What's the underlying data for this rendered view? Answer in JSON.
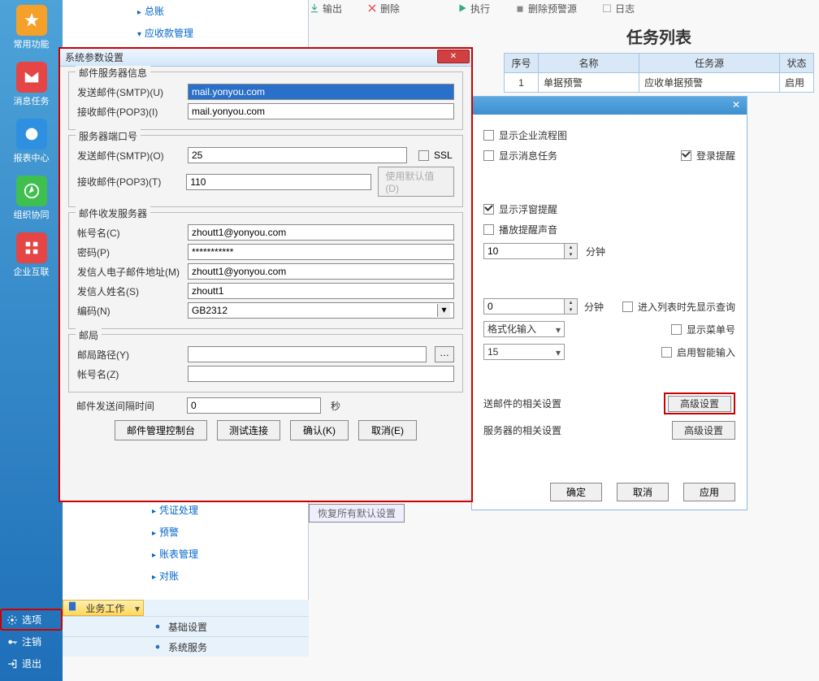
{
  "sidebar": {
    "items": [
      {
        "label": "常用功能",
        "color": "#f5a028"
      },
      {
        "label": "消息任务",
        "color": "#e64545"
      },
      {
        "label": "报表中心",
        "color": "#2f8fe0"
      },
      {
        "label": "组织协同",
        "color": "#3fbf4f"
      },
      {
        "label": "企业互联",
        "color": "#e64545"
      }
    ],
    "bottom": {
      "options": "选项",
      "logout": "注销",
      "exit": "退出"
    }
  },
  "tree": {
    "items": [
      {
        "label": "总账",
        "lv": 1,
        "arrow": "▶"
      },
      {
        "label": "应收款管理",
        "lv": 1,
        "arrow": "▼"
      },
      {
        "label": "凭证处理",
        "lv": 2,
        "arrow": "▶"
      },
      {
        "label": "预警",
        "lv": 2,
        "arrow": "▶"
      },
      {
        "label": "账表管理",
        "lv": 2,
        "arrow": "▶"
      },
      {
        "label": "对账",
        "lv": 2,
        "arrow": "▶"
      }
    ]
  },
  "cats": {
    "biz": "业务工作",
    "base": "基础设置",
    "sys": "系统服务"
  },
  "toolbar": {
    "output": "输出",
    "delete": "删除",
    "exec": "执行",
    "delalert": "删除预警源",
    "log": "日志"
  },
  "tasklist": {
    "title": "任务列表",
    "cols": {
      "no": "序号",
      "name": "名称",
      "src": "任务源",
      "stat": "状态"
    },
    "row": {
      "no": "1",
      "name": "单据预警",
      "src": "应收单据预警",
      "stat": "启用"
    }
  },
  "under": {
    "show_flow": "显示企业流程图",
    "show_msg": "显示消息任务",
    "login_remind": "登录提醒",
    "show_float": "显示浮窗提醒",
    "play_sound": "播放提醒声音",
    "interval": "10",
    "interval_unit": "分钟",
    "v2": "0",
    "v2_unit": "分钟",
    "enter_query": "进入列表时先显示查询",
    "fmt_input": "格式化输入",
    "show_menu": "显示菜单号",
    "v3": "15",
    "enable_smart": "启用智能输入",
    "mail_related": "送邮件的相关设置",
    "server_related": "服务器的相关设置",
    "adv": "高级设置",
    "ok": "确定",
    "cancel": "取消",
    "apply": "应用"
  },
  "restore": "恢复所有默认设置",
  "modal": {
    "title": "系统参数设置",
    "g1": "邮件服务器信息",
    "smtp_label": "发送邮件(SMTP)(U)",
    "smtp": "mail.yonyou.com",
    "pop_label": "接收邮件(POP3)(I)",
    "pop": "mail.yonyou.com",
    "g2": "服务器端口号",
    "smtp_port_label": "发送邮件(SMTP)(O)",
    "smtp_port": "25",
    "ssl": "SSL",
    "pop_port_label": "接收邮件(POP3)(T)",
    "pop_port": "110",
    "use_default": "使用默认值(D)",
    "g3": "邮件收发服务器",
    "acct_label": "帐号名(C)",
    "acct": "zhoutt1@yonyou.com",
    "pwd_label": "密码(P)",
    "pwd": "***********",
    "sender_mail_label": "发信人电子邮件地址(M)",
    "sender_mail": "zhoutt1@yonyou.com",
    "sender_name_label": "发信人姓名(S)",
    "sender_name": "zhoutt1",
    "enc_label": "编码(N)",
    "enc": "GB2312",
    "g4": "邮局",
    "popath_label": "邮局路径(Y)",
    "popath": "",
    "poacct_label": "帐号名(Z)",
    "poacct": "",
    "interval_label": "邮件发送间隔时间",
    "interval": "0",
    "interval_unit": "秒",
    "btn_console": "邮件管理控制台",
    "btn_test": "测试连接",
    "btn_ok": "确认(K)",
    "btn_cancel": "取消(E)"
  }
}
